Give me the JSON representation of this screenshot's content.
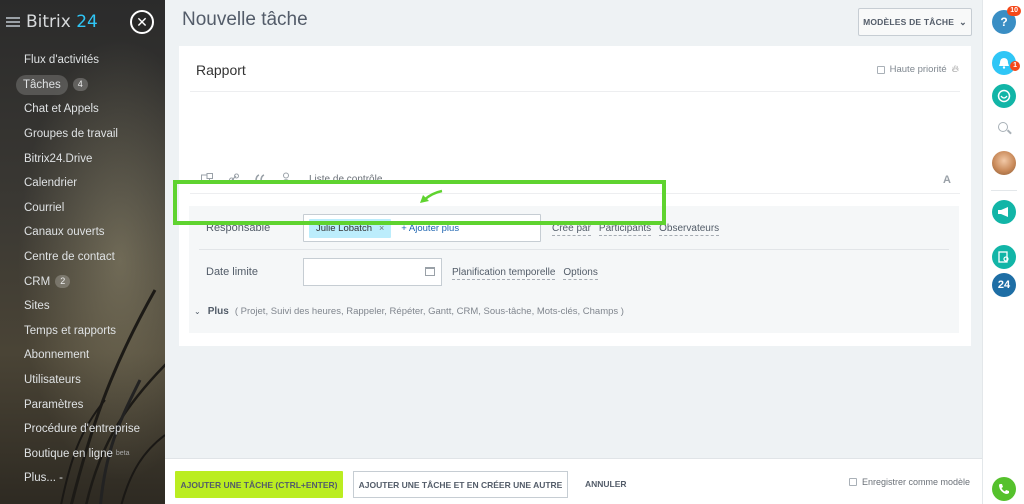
{
  "sidebar": {
    "logo_prefix": "Bitrix",
    "logo_number": "24",
    "items": [
      {
        "label": "Flux d'activités",
        "counter": ""
      },
      {
        "label": "Tâches",
        "counter": "4"
      },
      {
        "label": "Chat et Appels",
        "counter": ""
      },
      {
        "label": "Groupes de travail",
        "counter": ""
      },
      {
        "label": "Bitrix24.Drive",
        "counter": ""
      },
      {
        "label": "Calendrier",
        "counter": ""
      },
      {
        "label": "Courriel",
        "counter": ""
      },
      {
        "label": "Canaux ouverts",
        "counter": ""
      },
      {
        "label": "Centre de contact",
        "counter": ""
      },
      {
        "label": "CRM",
        "counter": "2"
      },
      {
        "label": "Sites",
        "counter": ""
      },
      {
        "label": "Temps et rapports",
        "counter": ""
      },
      {
        "label": "Abonnement",
        "counter": ""
      },
      {
        "label": "Utilisateurs",
        "counter": ""
      },
      {
        "label": "Paramètres",
        "counter": ""
      },
      {
        "label": "Procédure d'entreprise",
        "counter": ""
      },
      {
        "label": "Boutique en ligne",
        "counter": "",
        "beta": "beta"
      },
      {
        "label": "Plus... -",
        "counter": ""
      }
    ],
    "close_symbol": "✕"
  },
  "header": {
    "title": "Nouvelle tâche",
    "templates_button": "MODÈLES DE TÂCHE",
    "chevron": "⌄"
  },
  "task": {
    "title": "Rapport",
    "priority_label": "Haute priorité",
    "toolbar_checklist": "Liste de contrôle",
    "toolbar_font": "A",
    "responsible_label": "Responsable",
    "responsible_chip": "Julie Lobatch",
    "chip_remove": "×",
    "add_more": "+ Ajouter plus",
    "links_row1": [
      "Créé par",
      "Participants",
      "Observateurs"
    ],
    "deadline_label": "Date limite",
    "links_row2": [
      "Planification temporelle",
      "Options"
    ],
    "plus_label": "Plus",
    "plus_items": "( Projet,  Suivi des heures,  Rappeler,  Répéter,  Gantt,  CRM,  Sous-tâche,  Mots-clés,  Champs )"
  },
  "footer": {
    "add_task": "AJOUTER UNE TÂCHE (CTRL+ENTER)",
    "add_and_create": "AJOUTER UNE TÂCHE ET EN CRÉER UNE AUTRE",
    "cancel": "ANNULER",
    "save_template": "Enregistrer comme modèle"
  },
  "rightbar": {
    "help_badge": "10",
    "notif_badge": "1",
    "help_symbol": "?",
    "b24": "24"
  },
  "colors": {
    "accent_green": "#bbed21",
    "highlight_green": "#5fd32f",
    "chip_blue": "#bcedfc",
    "link_blue": "#1e65b1"
  }
}
